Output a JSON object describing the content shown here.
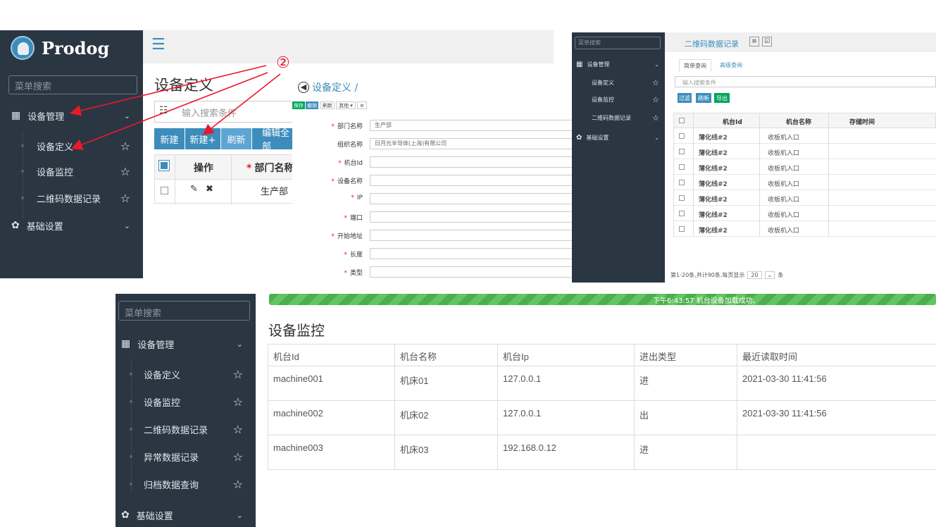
{
  "panel_a": {
    "logo_text": "Prodog",
    "search_placeholder": "菜单搜索",
    "menu_group": "设备管理",
    "items": [
      "设备定义",
      "设备监控",
      "二维码数据记录"
    ],
    "group2": "基础设置",
    "page_title": "设备定义",
    "search_field": "输入搜索条件",
    "toolbar": [
      "新建",
      "新建+",
      "刷新",
      "编辑全部"
    ],
    "table_header_op": "操作",
    "table_header_dept": "部门名称",
    "row_dept": "生产部",
    "annotation": "②"
  },
  "panel_b": {
    "breadcrumb": "设备定义 /",
    "toolbar": [
      "保存",
      "撤销",
      "刷新",
      "其他 ▾",
      "≡"
    ],
    "fields": [
      {
        "label": "部门名称",
        "required": true,
        "value": "生产部"
      },
      {
        "label": "组织名称",
        "required": false,
        "value": "日月光半导体(上海)有限公司"
      },
      {
        "label": "机台Id",
        "required": true,
        "value": ""
      },
      {
        "label": "设备名称",
        "required": true,
        "value": ""
      },
      {
        "label": "IP",
        "required": true,
        "value": ""
      },
      {
        "label": "端口",
        "required": true,
        "value": ""
      },
      {
        "label": "开始地址",
        "required": true,
        "value": ""
      },
      {
        "label": "长度",
        "required": true,
        "value": ""
      },
      {
        "label": "类型",
        "required": true,
        "value": ""
      }
    ]
  },
  "panel_c": {
    "search_placeholder": "菜单搜索",
    "menu_group": "设备管理",
    "items": [
      "设备定义",
      "设备监控",
      "二维码数据记录"
    ],
    "group2": "基础设置",
    "tab_title": "二维码数据记录",
    "subtabs": [
      "简单查询",
      "高级查询"
    ],
    "search_field": "输入搜索条件",
    "buttons": [
      "过滤",
      "刷新",
      "导出"
    ],
    "headers": [
      "机台Id",
      "机台名称",
      "存储时间"
    ],
    "rows": [
      [
        "薄化线#2",
        "收板机入口"
      ],
      [
        "薄化线#2",
        "收板机入口"
      ],
      [
        "薄化线#2",
        "收板机入口"
      ],
      [
        "薄化线#2",
        "收板机入口"
      ],
      [
        "薄化线#2",
        "收板机入口"
      ],
      [
        "薄化线#2",
        "收板机入口"
      ],
      [
        "薄化线#2",
        "收板机入口"
      ]
    ],
    "footer_text": "第1-20条,共计90条,每页显示",
    "page_size": "20",
    "footer_suffix": "条"
  },
  "panel_d": {
    "search_placeholder": "菜单搜索",
    "menu_group": "设备管理",
    "items": [
      "设备定义",
      "设备监控",
      "二维码数据记录",
      "异常数据记录",
      "归档数据查询"
    ],
    "group2": "基础设置",
    "banner": "下午6:43:57 机台设备加载成功。",
    "page_title": "设备监控",
    "headers": [
      "机台Id",
      "机台名称",
      "机台Ip",
      "进出类型",
      "最近读取时间"
    ],
    "rows": [
      [
        "machine001",
        "机床01",
        "127.0.0.1",
        "进",
        "2021-03-30 11:41:56"
      ],
      [
        "machine002",
        "机床02",
        "127.0.0.1",
        "出",
        "2021-03-30 11:41:56"
      ],
      [
        "machine003",
        "机床03",
        "192.168.0.12",
        "进",
        ""
      ]
    ]
  }
}
